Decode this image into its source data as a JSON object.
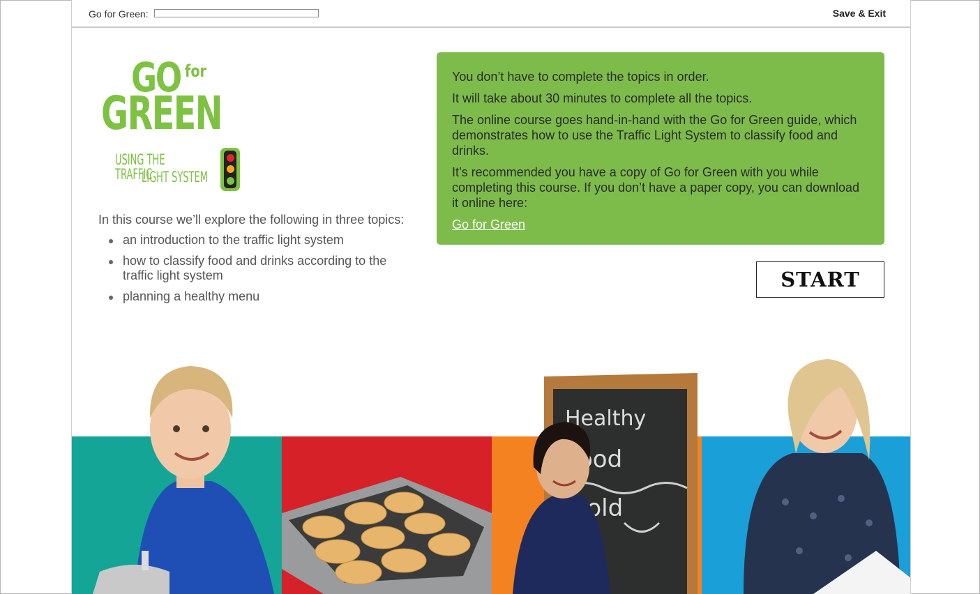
{
  "header": {
    "course_title": "Go for Green:",
    "progress": 0.0,
    "save_exit_label": "Save & Exit"
  },
  "logo": {
    "go": "GO",
    "for": "for",
    "green": "GREEN",
    "subtitle_line1": "USING THE TRAFFIC",
    "subtitle_line2": "LIGHT SYSTEM"
  },
  "intro": {
    "lead": "In this course we’ll explore the following in three topics:",
    "topics": [
      "an introduction to the traffic light system",
      "how to classify food and drinks according to the traffic light system",
      "planning a healthy menu"
    ]
  },
  "infobox": {
    "p1": "You don’t have to complete the topics in order.",
    "p2": "It will take about 30 minutes to complete all the topics.",
    "p3": "The online course goes hand-in-hand with the Go for Green guide, which demonstrates how to use the Traffic Light System to classify food and drinks.",
    "p4": "It’s recommended you have a copy of Go for Green with you while completing this course. If you don’t have a paper copy, you can download it online here:",
    "link_label": "Go for Green",
    "bg_color": "#7dbc4b"
  },
  "start_button": {
    "label": "START"
  },
  "chalkboard": {
    "line1": "Healthy",
    "line2": "food",
    "line3": "Gold"
  },
  "panel_colors": {
    "teal": "#14a596",
    "red": "#d62128",
    "orange": "#f58220",
    "blue": "#1a9fd8"
  }
}
